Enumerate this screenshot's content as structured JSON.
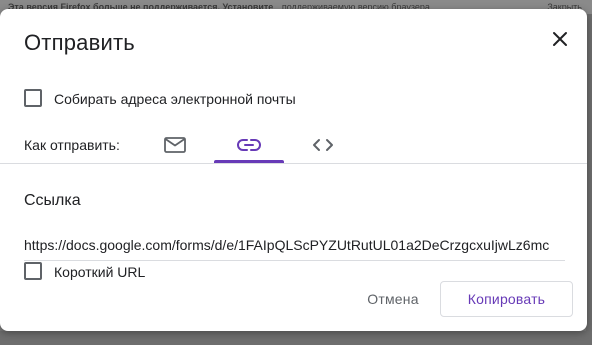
{
  "background": {
    "notice_bold": "Эта версия Firefox больше не поддерживается. Установите",
    "notice_link": "поддерживаемую версию браузера.",
    "notice_close": "Закрыть"
  },
  "dialog": {
    "title": "Отправить",
    "close_icon": "close-icon",
    "collect_emails_label": "Собирать адреса электронной почты",
    "collect_emails_checked": false,
    "send_via_label": "Как отправить:",
    "tabs": [
      {
        "name": "email",
        "icon": "envelope-icon",
        "active": false
      },
      {
        "name": "link",
        "icon": "link-icon",
        "active": true
      },
      {
        "name": "embed",
        "icon": "code-icon",
        "active": false
      }
    ],
    "section_title": "Ссылка",
    "link_value": "https://docs.google.com/forms/d/e/1FAIpQLScPYZUtRutUL01a2DeCrzgcxuIjwLz6mc",
    "short_url_label": "Короткий URL",
    "short_url_checked": false,
    "cancel_label": "Отмена",
    "copy_label": "Копировать"
  },
  "colors": {
    "accent": "#673ab7",
    "text_primary": "#202124",
    "text_secondary": "#5f6368",
    "divider": "#dadce0"
  }
}
